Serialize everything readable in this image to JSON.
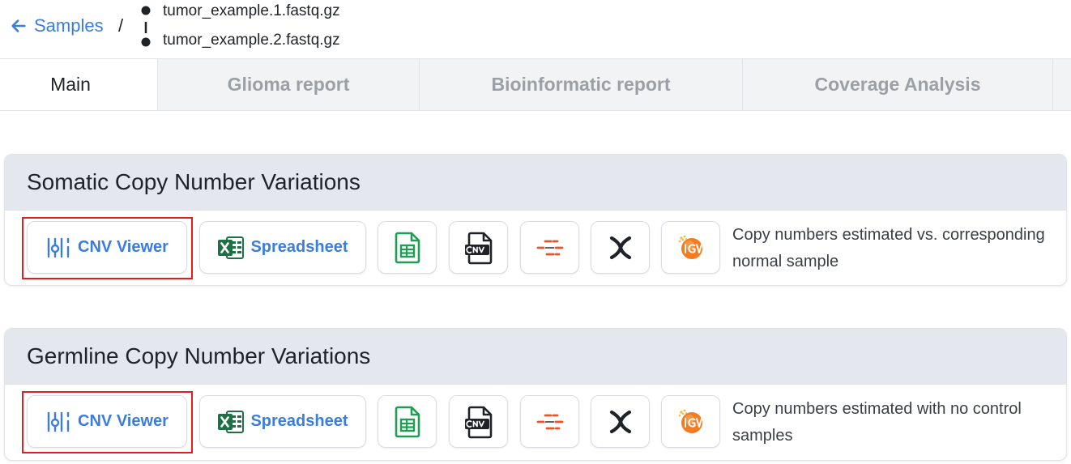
{
  "header": {
    "back_label": "Samples",
    "separator": "/",
    "files": [
      "tumor_example.1.fastq.gz",
      "tumor_example.2.fastq.gz"
    ]
  },
  "tabs": [
    {
      "label": "Main",
      "active": true
    },
    {
      "label": "Glioma report",
      "active": false
    },
    {
      "label": "Bioinformatic report",
      "active": false
    },
    {
      "label": "Coverage Analysis",
      "active": false
    }
  ],
  "sections": [
    {
      "title": "Somatic Copy Number Variations",
      "cnv_viewer_label": "CNV Viewer",
      "spreadsheet_label": "Spreadsheet",
      "description": "Copy numbers estimated vs. corresponding normal sample",
      "highlighted": "cnv-viewer-button"
    },
    {
      "title": "Germline Copy Number Variations",
      "cnv_viewer_label": "CNV Viewer",
      "spreadsheet_label": "Spreadsheet",
      "description": "Copy numbers estimated with no control samples",
      "highlighted": "cnv-viewer-button"
    }
  ],
  "icons": [
    "arrow-left-icon",
    "cnv-viewer-icon",
    "excel-icon",
    "google-sheets-icon",
    "cnv-file-icon",
    "segments-icon",
    "chromosome-icon",
    "igv-icon"
  ],
  "colors": {
    "link": "#3b7ddd",
    "highlight": "#e01e1e",
    "card_header": "#e4e7ee",
    "tab_inactive": "#9aa0a6",
    "excel_green": "#1e7145",
    "sheets_green": "#1f9d55",
    "segment_orange": "#e8542b",
    "igv_orange": "#f47b20"
  }
}
